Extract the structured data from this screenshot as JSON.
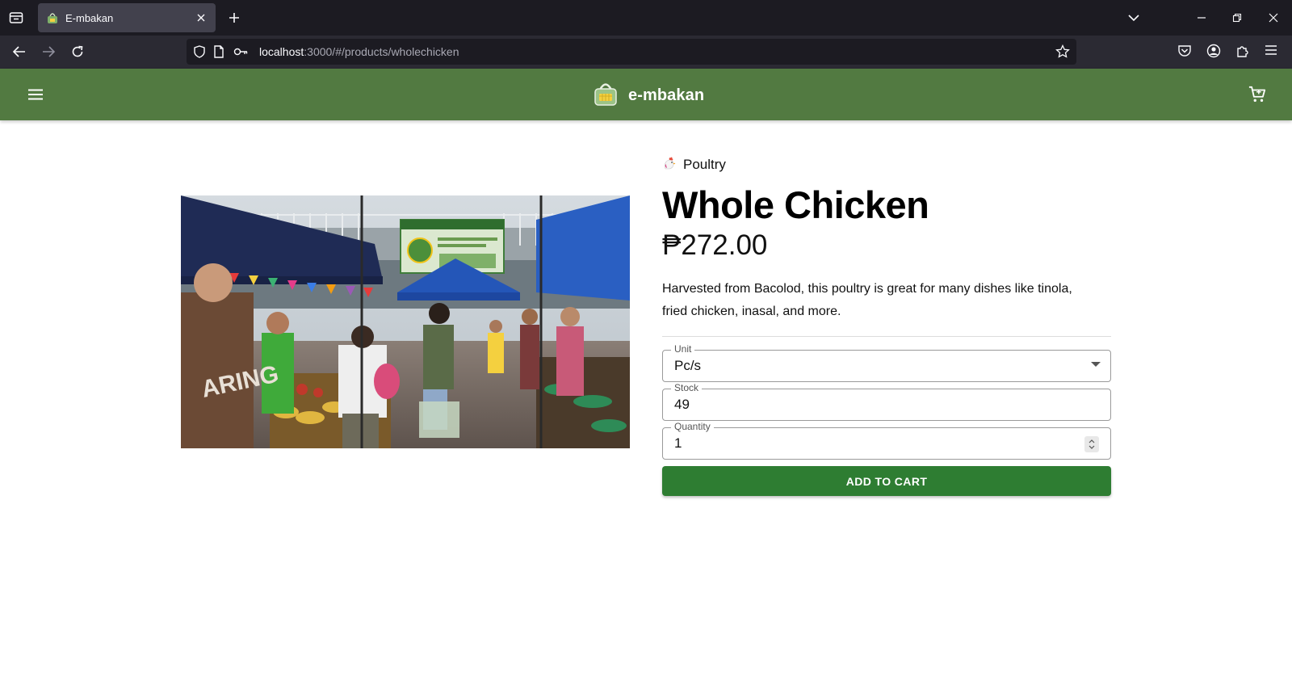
{
  "browser": {
    "tab": {
      "title": "E-mbakan",
      "favicon": "basket-icon"
    },
    "url": {
      "host": "localhost",
      "rest": ":3000/#/products/wholechicken"
    }
  },
  "app": {
    "brand": "e-mbakan",
    "header_bg": "#527a41"
  },
  "product": {
    "category": "Poultry",
    "category_icon": "chicken-icon",
    "title": "Whole Chicken",
    "price": "₱272.00",
    "description": "Harvested from Bacolod, this poultry is great for many dishes like tinola, fried chicken, inasal, and more."
  },
  "form": {
    "unit": {
      "label": "Unit",
      "value": "Pc/s"
    },
    "stock": {
      "label": "Stock",
      "value": "49"
    },
    "quantity": {
      "label": "Quantity",
      "value": "1"
    },
    "add_to_cart": "ADD TO CART",
    "button_color": "#2e7d32"
  }
}
